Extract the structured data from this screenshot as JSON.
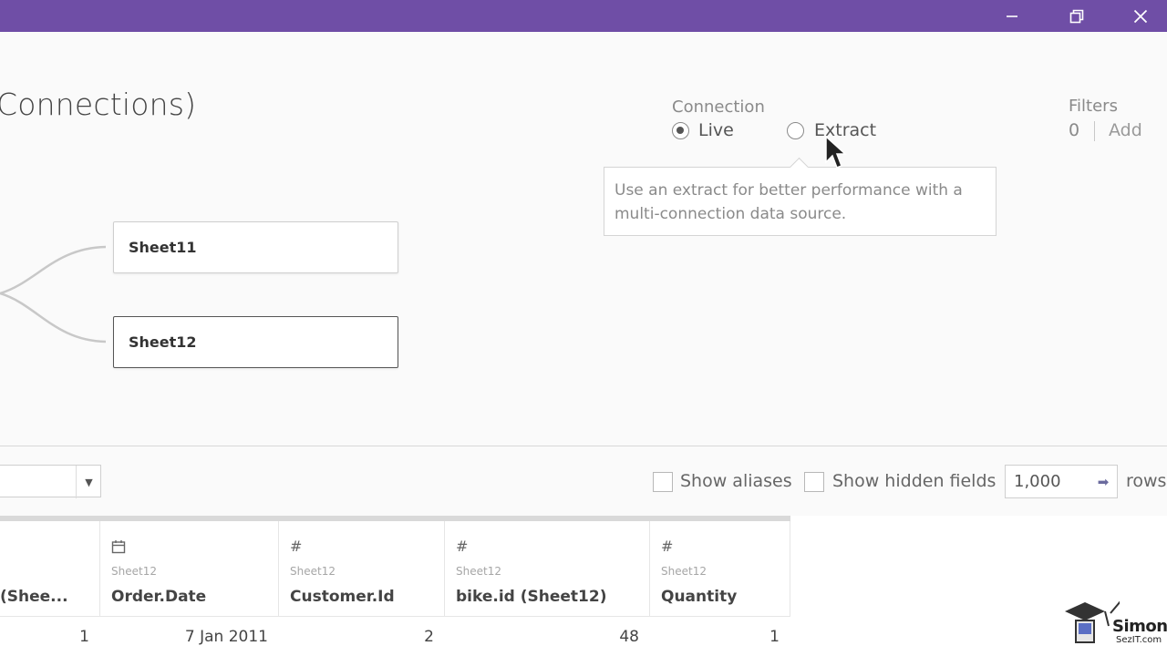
{
  "window": {
    "titlebar_color": "#6f4ea6",
    "buttons": [
      "minimize-icon",
      "restore-icon",
      "close-icon"
    ]
  },
  "datasource": {
    "title": "Connections)"
  },
  "connection": {
    "label": "Connection",
    "options": [
      {
        "label": "Live",
        "selected": true
      },
      {
        "label": "Extract",
        "selected": false
      }
    ],
    "tooltip": "Use an extract for better performance with a multi-connection data source."
  },
  "filters": {
    "label": "Filters",
    "count": "0",
    "add_label": "Add"
  },
  "tables": [
    {
      "name": "Sheet11"
    },
    {
      "name": "Sheet12"
    }
  ],
  "toolbar": {
    "show_aliases": "Show aliases",
    "show_hidden": "Show hidden fields",
    "rows_value": "1,000",
    "rows_label": "rows"
  },
  "grid": {
    "columns": [
      {
        "icon": "",
        "source": "",
        "name": "(Shee..."
      },
      {
        "icon": "calendar-icon",
        "source": "Sheet12",
        "name": "Order.Date"
      },
      {
        "icon": "number-icon",
        "source": "Sheet12",
        "name": "Customer.Id"
      },
      {
        "icon": "number-icon",
        "source": "Sheet12",
        "name": "bike.id (Sheet12)"
      },
      {
        "icon": "number-icon",
        "source": "Sheet12",
        "name": "Quantity"
      }
    ],
    "rows": [
      [
        "1",
        "7 Jan 2011",
        "2",
        "48",
        "1"
      ]
    ]
  },
  "watermark": {
    "name": "Simon",
    "sub": "SezIT.com"
  }
}
